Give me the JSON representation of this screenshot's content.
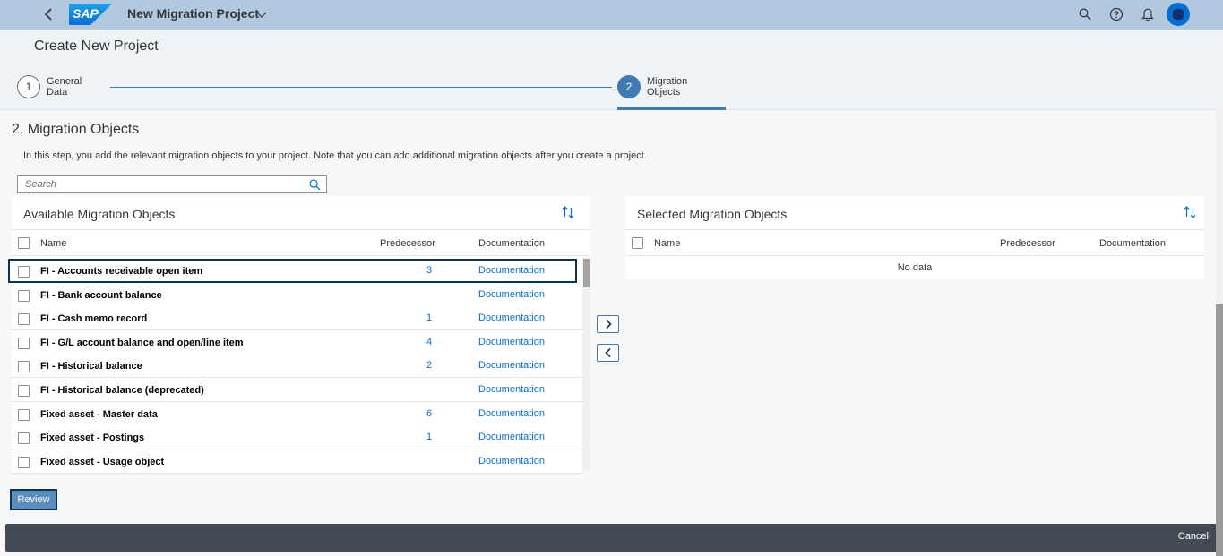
{
  "shell": {
    "app_title": "New Migration Project",
    "logo_text": "SAP",
    "icons": [
      "back-icon",
      "search-icon",
      "help-icon",
      "bell-icon",
      "user-avatar"
    ],
    "colors": {
      "shellbar": "#b2c8de",
      "accent": "#3f7ab2",
      "link": "#0a6ed1",
      "footer": "#434a53"
    }
  },
  "header": {
    "title": "Create New Project",
    "steps": [
      {
        "number": "1",
        "label": "General Data",
        "active": false
      },
      {
        "number": "2",
        "label": "Migration Objects",
        "active": true
      }
    ]
  },
  "content": {
    "section_title": "2. Migration Objects",
    "intro": "In this step, you add the relevant migration objects to your project. Note that you can add additional migration objects after you create a project.",
    "search_placeholder": "Search"
  },
  "available": {
    "title": "Available Migration Objects",
    "columns": {
      "name": "Name",
      "predecessor": "Predecessor",
      "documentation": "Documentation"
    },
    "rows": [
      {
        "name": "FI - Accounts receivable open item",
        "predecessor": "3",
        "documentation": "Documentation"
      },
      {
        "name": "FI - Bank account balance",
        "predecessor": "",
        "documentation": "Documentation"
      },
      {
        "name": "FI - Cash memo record",
        "predecessor": "1",
        "documentation": "Documentation"
      },
      {
        "name": "FI - G/L account balance and open/line item",
        "predecessor": "4",
        "documentation": "Documentation"
      },
      {
        "name": "FI - Historical balance",
        "predecessor": "2",
        "documentation": "Documentation"
      },
      {
        "name": "FI - Historical balance (deprecated)",
        "predecessor": "",
        "documentation": "Documentation"
      },
      {
        "name": "Fixed asset - Master data",
        "predecessor": "6",
        "documentation": "Documentation"
      },
      {
        "name": "Fixed asset - Postings",
        "predecessor": "1",
        "documentation": "Documentation"
      },
      {
        "name": "Fixed asset - Usage object",
        "predecessor": "",
        "documentation": "Documentation"
      }
    ]
  },
  "selected": {
    "title": "Selected Migration Objects",
    "columns": {
      "name": "Name",
      "predecessor": "Predecessor",
      "documentation": "Documentation"
    },
    "empty_text": "No data"
  },
  "actions": {
    "review": "Review",
    "cancel": "Cancel"
  }
}
